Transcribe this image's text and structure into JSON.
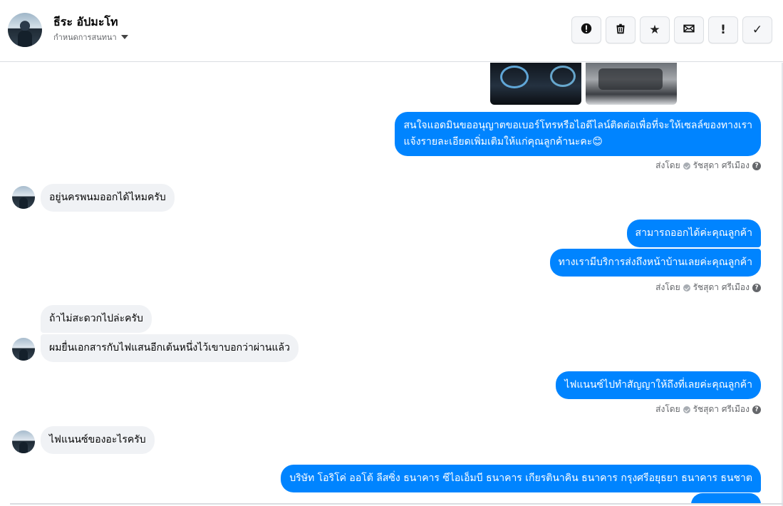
{
  "header": {
    "contact_name": "ธีระ อัปมะโท",
    "subtitle": "กำหนดการสนทนา",
    "avatar_icon": "profile-photo",
    "toolbar": [
      {
        "name": "report-button",
        "icon": "exclamation-circle-icon",
        "glyph": "!"
      },
      {
        "name": "delete-button",
        "icon": "trash-icon",
        "glyph": ""
      },
      {
        "name": "star-button",
        "icon": "star-icon",
        "glyph": "★"
      },
      {
        "name": "mail-button",
        "icon": "envelope-icon",
        "glyph": ""
      },
      {
        "name": "mark-unread-button",
        "icon": "exclamation-icon",
        "glyph": "!"
      },
      {
        "name": "done-button",
        "icon": "check-icon",
        "glyph": "✓"
      }
    ]
  },
  "thread": {
    "messages": [
      {
        "direction": "out",
        "lines": [
          "สนใจแอดมินขออนุญาตขอเบอร์โทรหรือไอดีไลน์ติดต่อเพื่อที่จะให้เซลล์ของทางเรา",
          "แจ้งรายละเอียดเพิ่มเติมให้แก่คุณลูกค้านะคะ😊"
        ]
      },
      {
        "direction": "in",
        "text": "อยู่นครพนมออกได้ไหมครับ"
      },
      {
        "direction": "out",
        "text": "สามารถออกได้ค่ะคุณลูกค้า"
      },
      {
        "direction": "out",
        "text": "ทางเรามีบริการส่งถึงหน้าบ้านเลยค่ะคุณลูกค้า"
      },
      {
        "direction": "in",
        "text": "ถ้าไม่สะดวกไปล่ะครับ"
      },
      {
        "direction": "in",
        "text": "ผมยื่นเอกสารกับไฟแสนอีกเต้นหนึ่งไว้เขาบอกว่าผ่านแล้ว"
      },
      {
        "direction": "out",
        "text": "ไฟแนนซ์ไปทำสัญญาให้ถึงที่เลยค่ะคุณลูกค้า"
      },
      {
        "direction": "in",
        "text": "ไฟแนนซ์ของอะไรครับ"
      },
      {
        "direction": "out",
        "text": "บริษัท โอริโค่ ออโต้ ลีสซิ่ง  ธนาคาร ซีไอเอ็มบี  ธนาคาร เกียรตินาคิน  ธนาคาร กรุงศรีอยุธยา   ธนาคาร ธนชาต"
      }
    ],
    "sent_by_prefix": "ส่งโดย",
    "sent_by_name": "รัชสุดา ศรีเมือง",
    "help_glyph": "?"
  },
  "colors": {
    "outgoing_bubble": "#0084ff",
    "incoming_bubble": "#f0f2f5",
    "secondary_text": "#65676b"
  }
}
